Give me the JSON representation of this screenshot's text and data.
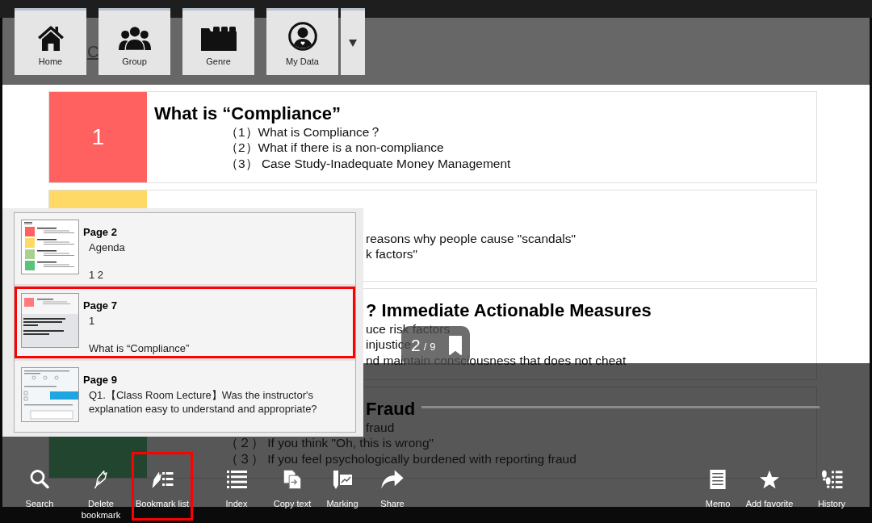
{
  "top_toolbar": {
    "buttons": [
      {
        "label": "Home"
      },
      {
        "label": "Group"
      },
      {
        "label": "Genre"
      },
      {
        "label": "My Data"
      }
    ]
  },
  "page_heading_fragment": "C",
  "agenda": [
    {
      "number": "1",
      "color": "#ff6161",
      "title": "What is “Compliance”",
      "items": [
        {
          "kind": "line",
          "text": "（1）What is Compliance？"
        },
        {
          "kind": "line",
          "text": "（2）What if there is a non-compliance"
        },
        {
          "kind": "line",
          "text": "（3） Case Study-Inadequate Money Management"
        }
      ]
    },
    {
      "color": "#ffd966",
      "items": [
        {
          "kind": "fragment",
          "text": "reasons why people cause \"scandals\""
        },
        {
          "kind": "fragment",
          "text": "k factors\""
        }
      ]
    },
    {
      "title_fragment": "? Immediate Actionable Measures",
      "items": [
        {
          "kind": "fragment",
          "text": "uce risk factors"
        },
        {
          "kind": "fragment",
          "text": "injustice"
        },
        {
          "kind": "fragment",
          "text": "nd maintain consciousness that does not cheat"
        }
      ]
    },
    {
      "color": "#22452f",
      "title_fragment": "Fraud",
      "items": [
        {
          "kind": "fragment",
          "text": "fraud"
        },
        {
          "kind": "line",
          "text": "（２） If you think \"Oh, this is wrong\""
        },
        {
          "kind": "line",
          "text": "（３） If you feel psychologically burdened with reporting fraud"
        }
      ]
    }
  ],
  "page_indicator": {
    "current": "2",
    "separator": "/",
    "total": "9",
    "bookmarked": true
  },
  "bookmark_popup": {
    "items": [
      {
        "page": "Page 2",
        "lines": [
          "Agenda",
          "1 2"
        ],
        "highlighted": false
      },
      {
        "page": "Page 7",
        "lines": [
          "1",
          "What is “Compliance”"
        ],
        "highlighted": true
      },
      {
        "page": "Page 9",
        "lines": [
          "Q1.【Class Room Lecture】Was the instructor's explanation easy to understand and appropriate?"
        ],
        "highlighted": false
      }
    ]
  },
  "bottom_toolbar": {
    "left": [
      {
        "label": "Search",
        "highlighted": false
      },
      {
        "label": "Delete bookmark",
        "highlighted": false
      },
      {
        "label": "Bookmark list",
        "highlighted": true
      },
      {
        "label": "Index",
        "highlighted": false
      },
      {
        "label": "Copy text",
        "highlighted": false
      },
      {
        "label": "Marking",
        "highlighted": false
      },
      {
        "label": "Share",
        "highlighted": false
      }
    ],
    "right": [
      {
        "label": "Memo",
        "highlighted": false
      },
      {
        "label": "Add favorite",
        "highlighted": false
      },
      {
        "label": "History",
        "highlighted": false
      }
    ]
  }
}
